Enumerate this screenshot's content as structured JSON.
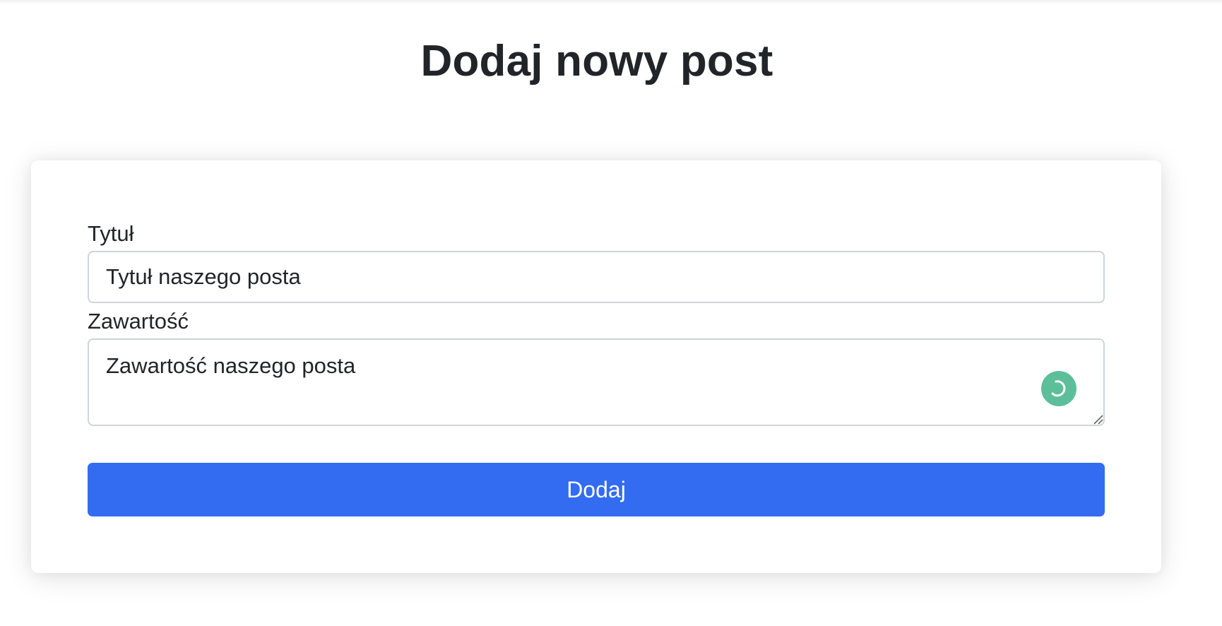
{
  "page": {
    "title": "Dodaj nowy post"
  },
  "form": {
    "title_label": "Tytuł",
    "title_value": "Tytuł naszego posta",
    "content_label": "Zawartość",
    "content_value": "Zawartość naszego posta",
    "submit_label": "Dodaj"
  },
  "icons": {
    "loader": "loading-spinner-icon",
    "resize": "resize-handle-icon"
  },
  "colors": {
    "primary": "#336cf1",
    "loader": "#5cbf9a",
    "text": "#212529",
    "border": "#ced4da"
  }
}
